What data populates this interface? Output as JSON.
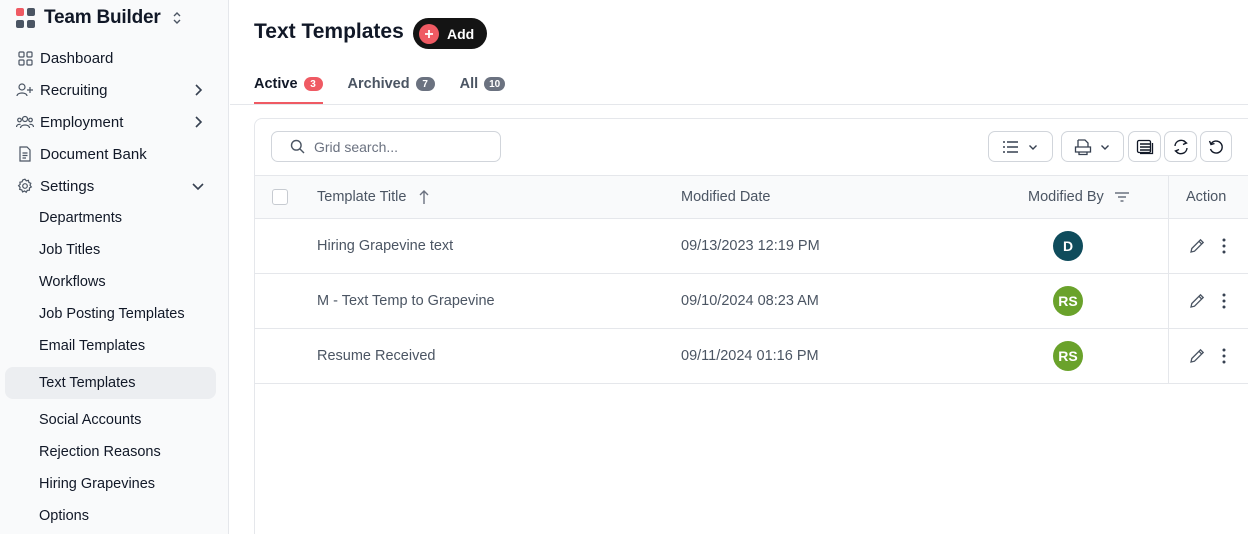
{
  "app": {
    "name": "Team Builder",
    "logo_colors": [
      "#ef5a63",
      "#4b5563",
      "#4b5563",
      "#4b5563"
    ]
  },
  "sidebar": {
    "items": [
      {
        "label": "Dashboard",
        "icon": "dashboard-grid-icon"
      },
      {
        "label": "Recruiting",
        "icon": "user-plus-icon",
        "chevron": "right"
      },
      {
        "label": "Employment",
        "icon": "users-icon",
        "chevron": "right"
      },
      {
        "label": "Document Bank",
        "icon": "document-icon"
      },
      {
        "label": "Settings",
        "icon": "gear-icon",
        "chevron": "down"
      }
    ],
    "settings_children": [
      {
        "label": "Departments"
      },
      {
        "label": "Job Titles"
      },
      {
        "label": "Workflows"
      },
      {
        "label": "Job Posting Templates"
      },
      {
        "label": "Email Templates"
      },
      {
        "label": "Text Templates",
        "active": true
      },
      {
        "label": "Social Accounts"
      },
      {
        "label": "Rejection Reasons"
      },
      {
        "label": "Hiring Grapevines"
      },
      {
        "label": "Options"
      }
    ]
  },
  "page": {
    "title": "Text Templates",
    "add_label": "Add"
  },
  "tabs": [
    {
      "label": "Active",
      "count": "3",
      "badge_color": "#ef5a63",
      "active": true
    },
    {
      "label": "Archived",
      "count": "7",
      "badge_color": "#6b7280"
    },
    {
      "label": "All",
      "count": "10",
      "badge_color": "#6b7280"
    }
  ],
  "grid": {
    "search_placeholder": "Grid search...",
    "toolbar_icons": [
      "list-columns-icon",
      "export-icon",
      "view-settings-icon",
      "refresh-icon",
      "reset-icon"
    ],
    "columns": {
      "title": "Template Title",
      "modified_date": "Modified Date",
      "modified_by": "Modified By",
      "action": "Action"
    },
    "sort": {
      "column": "Template Title",
      "direction": "ascending"
    },
    "rows": [
      {
        "title": "Hiring Grapevine text",
        "modified_date": "09/13/2023 12:19 PM",
        "modified_by": "D",
        "avatar_color": "#0f4c5c"
      },
      {
        "title": "M - Text Temp to Grapevine",
        "modified_date": "09/10/2024 08:23 AM",
        "modified_by": "RS",
        "avatar_color": "#6aa22b"
      },
      {
        "title": "Resume Received",
        "modified_date": "09/11/2024 01:16 PM",
        "modified_by": "RS",
        "avatar_color": "#6aa22b"
      }
    ]
  }
}
